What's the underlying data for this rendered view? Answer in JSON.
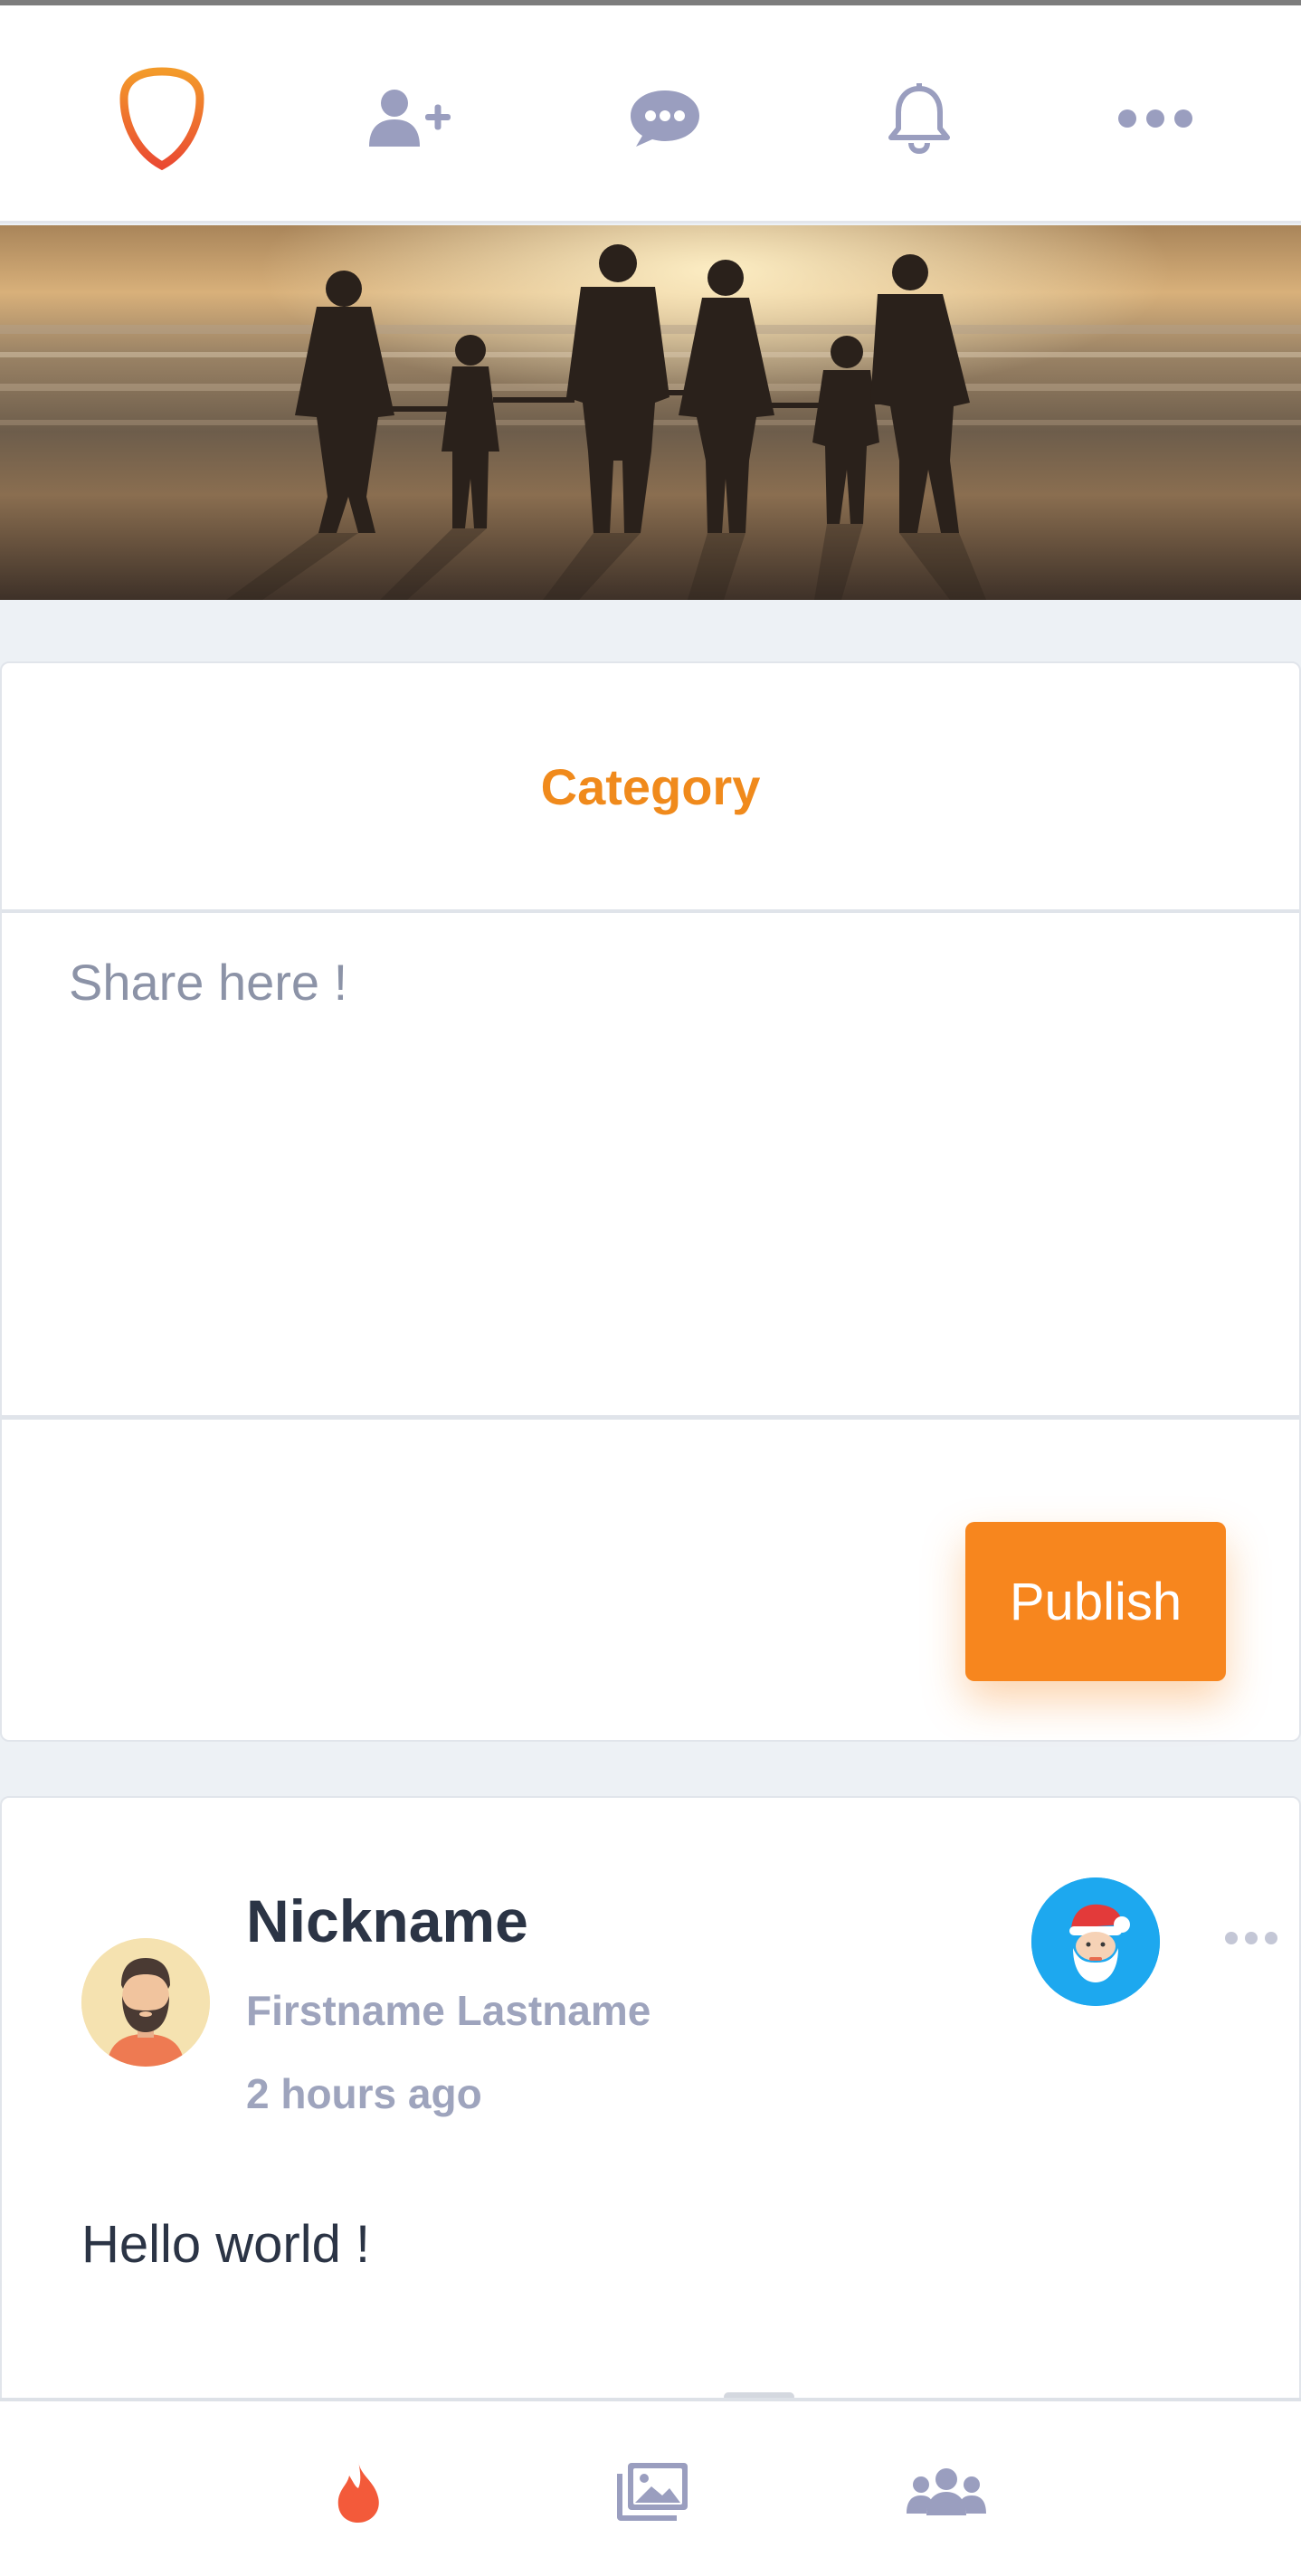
{
  "app": {
    "colors": {
      "accent": "#f7861e",
      "icon": "#9a9ebf",
      "text_dark": "#2b3445",
      "text_muted": "#9ea4bd",
      "page_bg": "#edf1f5"
    }
  },
  "top_nav": {
    "items": [
      {
        "icon": "shield-logo-icon"
      },
      {
        "icon": "add-friend-icon"
      },
      {
        "icon": "chat-icon"
      },
      {
        "icon": "bell-icon"
      },
      {
        "icon": "more-icon"
      }
    ]
  },
  "banner": {
    "image": "family-beach-sunset-photo"
  },
  "composer": {
    "category_label": "Category",
    "share_placeholder": "Share here !",
    "publish_label": "Publish"
  },
  "post": {
    "nickname": "Nickname",
    "full_name": "Firstname Lastname",
    "time_ago": "2 hours ago",
    "body": "Hello world !",
    "avatar_icon": "bearded-man-avatar",
    "badge_icon": "santa-badge-icon"
  },
  "bottom_nav": {
    "items": [
      {
        "icon": "flame-icon",
        "active": true
      },
      {
        "icon": "gallery-icon",
        "active": false
      },
      {
        "icon": "group-icon",
        "active": false
      }
    ]
  }
}
